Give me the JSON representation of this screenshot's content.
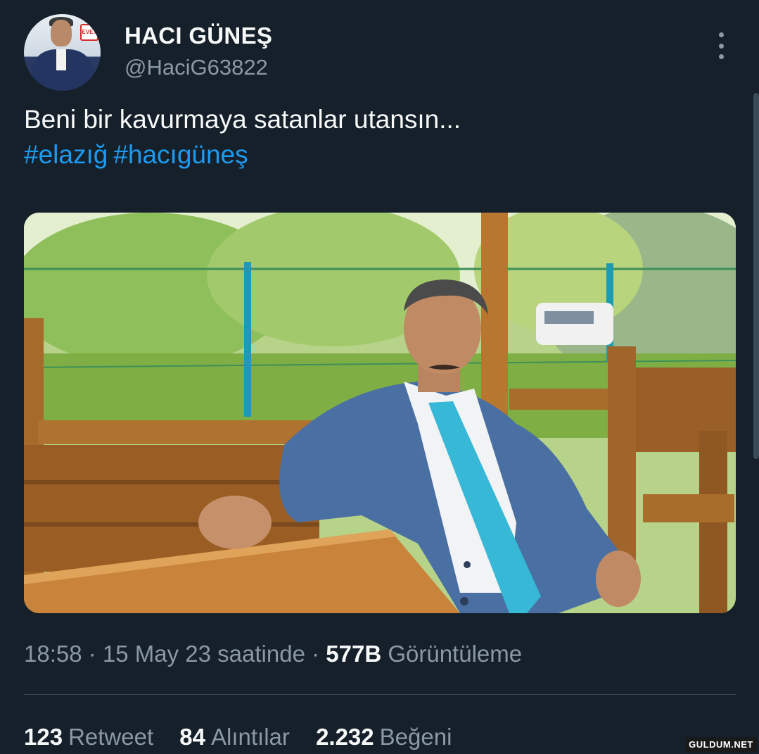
{
  "author": {
    "name": "HACI GÜNEŞ",
    "handle": "@HaciG63822",
    "avatar_badge": "EVET"
  },
  "tweet": {
    "text": "Beni bir kavurmaya satanlar utansın...",
    "hashtags": [
      "#elazığ",
      "#hacıgüneş"
    ]
  },
  "meta": {
    "time": "18:58",
    "sep1": " · ",
    "date": "15 May 23 saatinde",
    "sep2": " · ",
    "views_count": "577B",
    "views_label": "Görüntüleme"
  },
  "stats": {
    "retweets_count": "123",
    "retweets_label": "Retweet",
    "quotes_count": "84",
    "quotes_label": "Alıntılar",
    "likes_count": "2.232",
    "likes_label": "Beğeni"
  },
  "watermark": "GULDUM.NET",
  "icons": {
    "more": "more-vertical-icon"
  },
  "colors": {
    "background": "#15202b",
    "text_primary": "#f7f9f9",
    "text_secondary": "#8b98a5",
    "hashtag": "#1d9bf0",
    "divider": "#38444d"
  }
}
